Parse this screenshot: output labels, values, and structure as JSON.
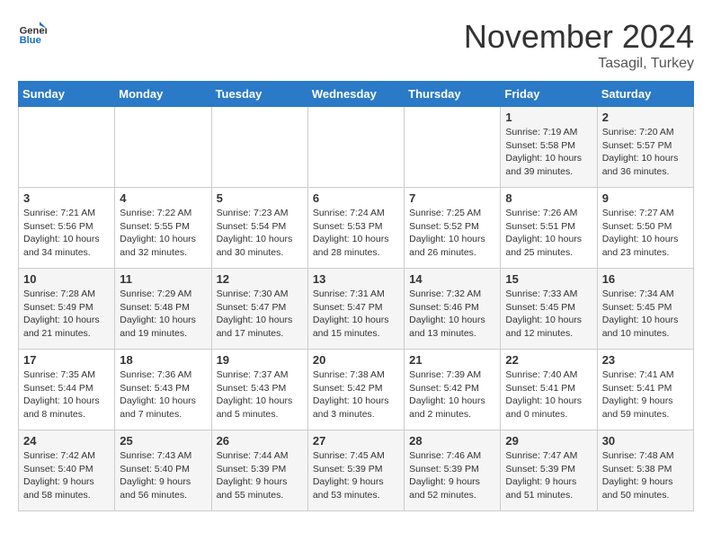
{
  "header": {
    "logo_general": "General",
    "logo_blue": "Blue",
    "month_title": "November 2024",
    "location": "Tasagil, Turkey"
  },
  "columns": [
    "Sunday",
    "Monday",
    "Tuesday",
    "Wednesday",
    "Thursday",
    "Friday",
    "Saturday"
  ],
  "weeks": [
    [
      {
        "day": "",
        "info": ""
      },
      {
        "day": "",
        "info": ""
      },
      {
        "day": "",
        "info": ""
      },
      {
        "day": "",
        "info": ""
      },
      {
        "day": "",
        "info": ""
      },
      {
        "day": "1",
        "info": "Sunrise: 7:19 AM\nSunset: 5:58 PM\nDaylight: 10 hours and 39 minutes."
      },
      {
        "day": "2",
        "info": "Sunrise: 7:20 AM\nSunset: 5:57 PM\nDaylight: 10 hours and 36 minutes."
      }
    ],
    [
      {
        "day": "3",
        "info": "Sunrise: 7:21 AM\nSunset: 5:56 PM\nDaylight: 10 hours and 34 minutes."
      },
      {
        "day": "4",
        "info": "Sunrise: 7:22 AM\nSunset: 5:55 PM\nDaylight: 10 hours and 32 minutes."
      },
      {
        "day": "5",
        "info": "Sunrise: 7:23 AM\nSunset: 5:54 PM\nDaylight: 10 hours and 30 minutes."
      },
      {
        "day": "6",
        "info": "Sunrise: 7:24 AM\nSunset: 5:53 PM\nDaylight: 10 hours and 28 minutes."
      },
      {
        "day": "7",
        "info": "Sunrise: 7:25 AM\nSunset: 5:52 PM\nDaylight: 10 hours and 26 minutes."
      },
      {
        "day": "8",
        "info": "Sunrise: 7:26 AM\nSunset: 5:51 PM\nDaylight: 10 hours and 25 minutes."
      },
      {
        "day": "9",
        "info": "Sunrise: 7:27 AM\nSunset: 5:50 PM\nDaylight: 10 hours and 23 minutes."
      }
    ],
    [
      {
        "day": "10",
        "info": "Sunrise: 7:28 AM\nSunset: 5:49 PM\nDaylight: 10 hours and 21 minutes."
      },
      {
        "day": "11",
        "info": "Sunrise: 7:29 AM\nSunset: 5:48 PM\nDaylight: 10 hours and 19 minutes."
      },
      {
        "day": "12",
        "info": "Sunrise: 7:30 AM\nSunset: 5:47 PM\nDaylight: 10 hours and 17 minutes."
      },
      {
        "day": "13",
        "info": "Sunrise: 7:31 AM\nSunset: 5:47 PM\nDaylight: 10 hours and 15 minutes."
      },
      {
        "day": "14",
        "info": "Sunrise: 7:32 AM\nSunset: 5:46 PM\nDaylight: 10 hours and 13 minutes."
      },
      {
        "day": "15",
        "info": "Sunrise: 7:33 AM\nSunset: 5:45 PM\nDaylight: 10 hours and 12 minutes."
      },
      {
        "day": "16",
        "info": "Sunrise: 7:34 AM\nSunset: 5:45 PM\nDaylight: 10 hours and 10 minutes."
      }
    ],
    [
      {
        "day": "17",
        "info": "Sunrise: 7:35 AM\nSunset: 5:44 PM\nDaylight: 10 hours and 8 minutes."
      },
      {
        "day": "18",
        "info": "Sunrise: 7:36 AM\nSunset: 5:43 PM\nDaylight: 10 hours and 7 minutes."
      },
      {
        "day": "19",
        "info": "Sunrise: 7:37 AM\nSunset: 5:43 PM\nDaylight: 10 hours and 5 minutes."
      },
      {
        "day": "20",
        "info": "Sunrise: 7:38 AM\nSunset: 5:42 PM\nDaylight: 10 hours and 3 minutes."
      },
      {
        "day": "21",
        "info": "Sunrise: 7:39 AM\nSunset: 5:42 PM\nDaylight: 10 hours and 2 minutes."
      },
      {
        "day": "22",
        "info": "Sunrise: 7:40 AM\nSunset: 5:41 PM\nDaylight: 10 hours and 0 minutes."
      },
      {
        "day": "23",
        "info": "Sunrise: 7:41 AM\nSunset: 5:41 PM\nDaylight: 9 hours and 59 minutes."
      }
    ],
    [
      {
        "day": "24",
        "info": "Sunrise: 7:42 AM\nSunset: 5:40 PM\nDaylight: 9 hours and 58 minutes."
      },
      {
        "day": "25",
        "info": "Sunrise: 7:43 AM\nSunset: 5:40 PM\nDaylight: 9 hours and 56 minutes."
      },
      {
        "day": "26",
        "info": "Sunrise: 7:44 AM\nSunset: 5:39 PM\nDaylight: 9 hours and 55 minutes."
      },
      {
        "day": "27",
        "info": "Sunrise: 7:45 AM\nSunset: 5:39 PM\nDaylight: 9 hours and 53 minutes."
      },
      {
        "day": "28",
        "info": "Sunrise: 7:46 AM\nSunset: 5:39 PM\nDaylight: 9 hours and 52 minutes."
      },
      {
        "day": "29",
        "info": "Sunrise: 7:47 AM\nSunset: 5:39 PM\nDaylight: 9 hours and 51 minutes."
      },
      {
        "day": "30",
        "info": "Sunrise: 7:48 AM\nSunset: 5:38 PM\nDaylight: 9 hours and 50 minutes."
      }
    ]
  ]
}
